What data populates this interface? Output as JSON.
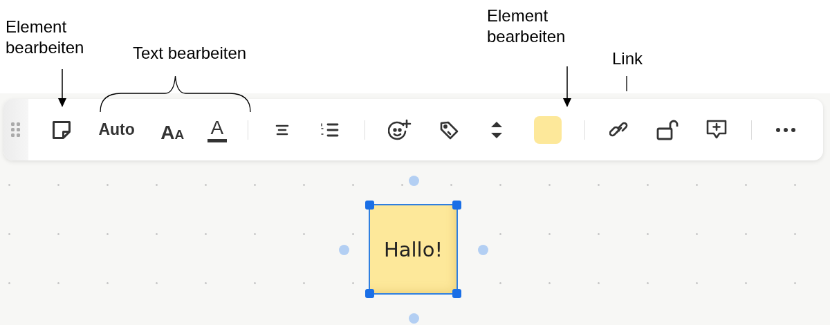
{
  "annotations": [
    {
      "text": "Element bearbeiten",
      "kind": "arrow"
    },
    {
      "text": "Text bearbeiten",
      "kind": "brace"
    },
    {
      "text": "Element bearbeiten",
      "kind": "arrow"
    },
    {
      "text": "Link",
      "kind": "line"
    }
  ],
  "toolbar": {
    "items": [
      {
        "kind": "sticky-note"
      },
      {
        "kind": "text",
        "label": "Auto"
      },
      {
        "kind": "text-size",
        "label": "AA"
      },
      {
        "kind": "text-color",
        "label": "A"
      },
      {
        "kind": "divider"
      },
      {
        "kind": "align"
      },
      {
        "kind": "numbered-list"
      },
      {
        "kind": "divider"
      },
      {
        "kind": "emoji"
      },
      {
        "kind": "tag"
      },
      {
        "kind": "order"
      },
      {
        "kind": "swatch",
        "color": "#fde89a"
      },
      {
        "kind": "divider"
      },
      {
        "kind": "link"
      },
      {
        "kind": "lock"
      },
      {
        "kind": "comment"
      },
      {
        "kind": "divider"
      },
      {
        "kind": "more"
      }
    ]
  },
  "note": {
    "text": "Hallo!",
    "selected": true
  }
}
